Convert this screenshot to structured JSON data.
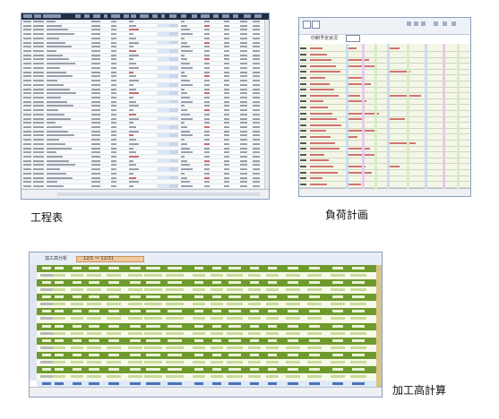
{
  "captions": {
    "process_table": "工程表",
    "load_plan": "負荷計画",
    "processing_amount": "加工高計算"
  },
  "load_plan_window": {
    "title": "印刷予定状況"
  },
  "processing_window": {
    "title": "加工高分析",
    "period": "12/1 〜 12/31"
  },
  "colors": {
    "window_border": "#8aa0c0",
    "header_dark": "#1f2d45",
    "band_green": "#6f9a2e",
    "band_blue": "#4a72b8",
    "period_orange": "#f0c89a"
  }
}
